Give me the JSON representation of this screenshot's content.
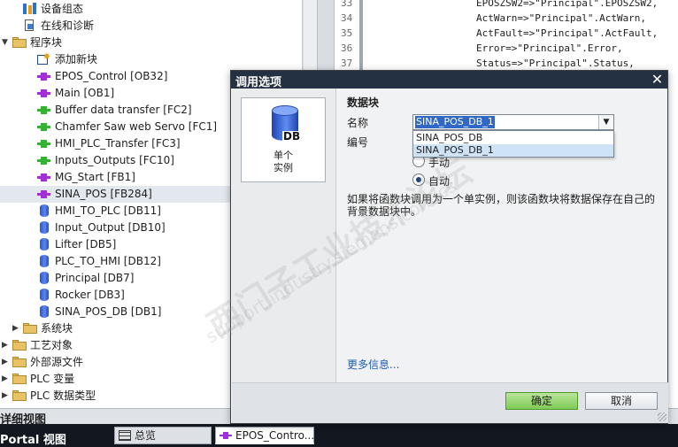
{
  "project_tree": {
    "items": [
      {
        "label": "设备组态",
        "icon": "device-config-icon",
        "level": 1,
        "expander": ""
      },
      {
        "label": "在线和诊断",
        "icon": "online-diagnostics-icon",
        "level": 1,
        "expander": ""
      },
      {
        "label": "程序块",
        "icon": "folder-icon",
        "level": 0,
        "expander": "expanded"
      },
      {
        "label": "添加新块",
        "icon": "add-block-icon",
        "level": 2,
        "expander": ""
      },
      {
        "label": "EPOS_Control [OB32]",
        "icon": "ob-icon",
        "level": 2,
        "expander": ""
      },
      {
        "label": "Main [OB1]",
        "icon": "ob-icon",
        "level": 2,
        "expander": ""
      },
      {
        "label": "Buffer data transfer [FC2]",
        "icon": "fc-icon",
        "level": 2,
        "expander": ""
      },
      {
        "label": "Chamfer Saw web Servo [FC1]",
        "icon": "fc-icon",
        "level": 2,
        "expander": ""
      },
      {
        "label": "HMI_PLC_Transfer [FC3]",
        "icon": "fc-icon",
        "level": 2,
        "expander": ""
      },
      {
        "label": "Inputs_Outputs [FC10]",
        "icon": "fc-icon",
        "level": 2,
        "expander": ""
      },
      {
        "label": "MG_Start [FB1]",
        "icon": "fb-icon",
        "level": 2,
        "expander": ""
      },
      {
        "label": "SINA_POS [FB284]",
        "icon": "fb-icon",
        "level": 2,
        "expander": "",
        "selected": true
      },
      {
        "label": "HMI_TO_PLC [DB11]",
        "icon": "db-icon",
        "level": 2,
        "expander": ""
      },
      {
        "label": "Input_Output [DB10]",
        "icon": "db-icon",
        "level": 2,
        "expander": ""
      },
      {
        "label": "Lifter [DB5]",
        "icon": "db-icon",
        "level": 2,
        "expander": ""
      },
      {
        "label": "PLC_TO_HMI [DB12]",
        "icon": "db-icon",
        "level": 2,
        "expander": ""
      },
      {
        "label": "Principal [DB7]",
        "icon": "db-icon",
        "level": 2,
        "expander": ""
      },
      {
        "label": "Rocker [DB3]",
        "icon": "db-icon",
        "level": 2,
        "expander": ""
      },
      {
        "label": "SINA_POS_DB [DB1]",
        "icon": "db-icon",
        "level": 2,
        "expander": ""
      },
      {
        "label": "系统块",
        "icon": "folder-icon",
        "level": 1,
        "expander": "collapsed"
      },
      {
        "label": "工艺对象",
        "icon": "technology-objects-icon",
        "level": 0,
        "expander": "collapsed"
      },
      {
        "label": "外部源文件",
        "icon": "external-sources-icon",
        "level": 0,
        "expander": "collapsed"
      },
      {
        "label": "PLC 变量",
        "icon": "plc-tags-icon",
        "level": 0,
        "expander": "collapsed"
      },
      {
        "label": "PLC 数据类型",
        "icon": "plc-datatypes-icon",
        "level": 0,
        "expander": "collapsed"
      }
    ]
  },
  "code_editor": {
    "lines": [
      {
        "number": "33",
        "text": "EPOSZSW2=>\"Principal\".EPOSZSW2,"
      },
      {
        "number": "34",
        "text": "ActWarn=>\"Principal\".ActWarn,"
      },
      {
        "number": "35",
        "text": "ActFault=>\"Principal\".ActFault,"
      },
      {
        "number": "36",
        "text": "Error=>\"Principal\".Error,"
      },
      {
        "number": "37",
        "text": "Status=>\"Principal\".Status,"
      }
    ]
  },
  "details_view": {
    "label": "详细视图"
  },
  "taskbar": {
    "portal_label": "Portal 视图",
    "tabs": [
      {
        "label": "总览",
        "icon": "overview-icon"
      },
      {
        "label": "EPOS_Contro...",
        "icon": "fb-icon"
      }
    ]
  },
  "dialog": {
    "title": "调用选项",
    "close_icon": "close-icon",
    "instance_option": {
      "icon_text": "DB",
      "label_line1": "单个",
      "label_line2": "实例"
    },
    "section_title": "数据块",
    "name_label": "名称",
    "name_value": "SINA_POS_DB_1",
    "number_label": "编号",
    "dropdown_options": [
      "SINA_POS_DB",
      "SINA_POS_DB_1"
    ],
    "radio_manual": "手动",
    "radio_auto": "自动",
    "radio_selected": "auto",
    "info_text": "如果将函数块调用为一个单实例，则该函数块将数据保存在自己的背景数据块中。",
    "more_info": "更多信息...",
    "ok_label": "确定",
    "cancel_label": "取消",
    "ok_color": "#7fcb55",
    "title_bar_color": "#243142"
  },
  "watermark": {
    "line1": "西门子工业技术论坛",
    "line2": "support.industry.siemens.com/cs"
  }
}
